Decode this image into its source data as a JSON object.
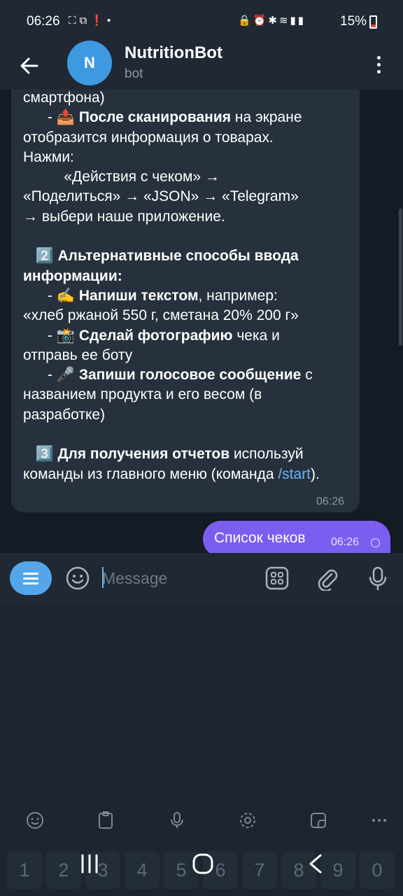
{
  "status_bar": {
    "time": "06:26",
    "battery": "15%",
    "left_icons": [
      "screenshot-icon",
      "screen-recorder-icon",
      "alert-icon",
      "dot-icon"
    ],
    "right_icons": [
      "lock-icon",
      "alarm-icon",
      "bluetooth-icon",
      "wifi-icon",
      "signal-icon",
      "signal-icon"
    ]
  },
  "header": {
    "avatar_letter": "N",
    "title": "NutritionBot",
    "subtitle": "bot"
  },
  "message_in": {
    "time": "06:26",
    "lines": {
      "l1": "смартфона)",
      "l2_prefix": "      - 📤 ",
      "l2_bold": "После сканирования",
      "l2_rest": " на экране",
      "l3": "отобразится информация о товарах.",
      "l4": "Нажми:",
      "l5": "          «Действия с чеком» →",
      "l6": "«Поделиться» → «JSON» → «Telegram»",
      "l7": "→ выбери наше приложение.",
      "s2_prefix": "   2️⃣ ",
      "s2_bold": "Альтернативные способы ввода информации:",
      "l8_prefix": "      - ✍️ ",
      "l8_bold": "Напиши текстом",
      "l8_rest": ", например:",
      "l9": "«хлеб ржаной 550 г, сметана 20% 200 г»",
      "l10_prefix": "      - 📸 ",
      "l10_bold": "Сделай фотографию",
      "l10_rest": " чека и",
      "l11": "отправь ее боту",
      "l12_prefix": "      - 🎤 ",
      "l12_bold": "Запиши голосовое сообщение",
      "l12_rest": " с",
      "l13": "названием продукта и его весом (в",
      "l14": "разработке)",
      "s3_prefix": "   3️⃣ ",
      "s3_bold": "Для получения отчетов",
      "s3_rest": " используй",
      "l15_prefix": "команды из главного меню (команда ",
      "l15_link": "/start",
      "l15_suffix": ")."
    }
  },
  "message_out": {
    "text": "Список чеков",
    "time": "06:26"
  },
  "input": {
    "placeholder": "Message",
    "value": ""
  },
  "toolbar_icons": [
    "emoji-panel-icon",
    "clipboard-icon",
    "voice-input-icon",
    "settings-icon",
    "sticker-icon",
    "more-icon"
  ],
  "number_row": [
    "1",
    "2",
    "3",
    "4",
    "5",
    "6",
    "7",
    "8",
    "9",
    "0"
  ],
  "colors": {
    "accent": "#55a6e8",
    "outgoing_bubble": "#7b5ef0",
    "incoming_bubble": "#26313d",
    "link": "#6ab3f3"
  }
}
